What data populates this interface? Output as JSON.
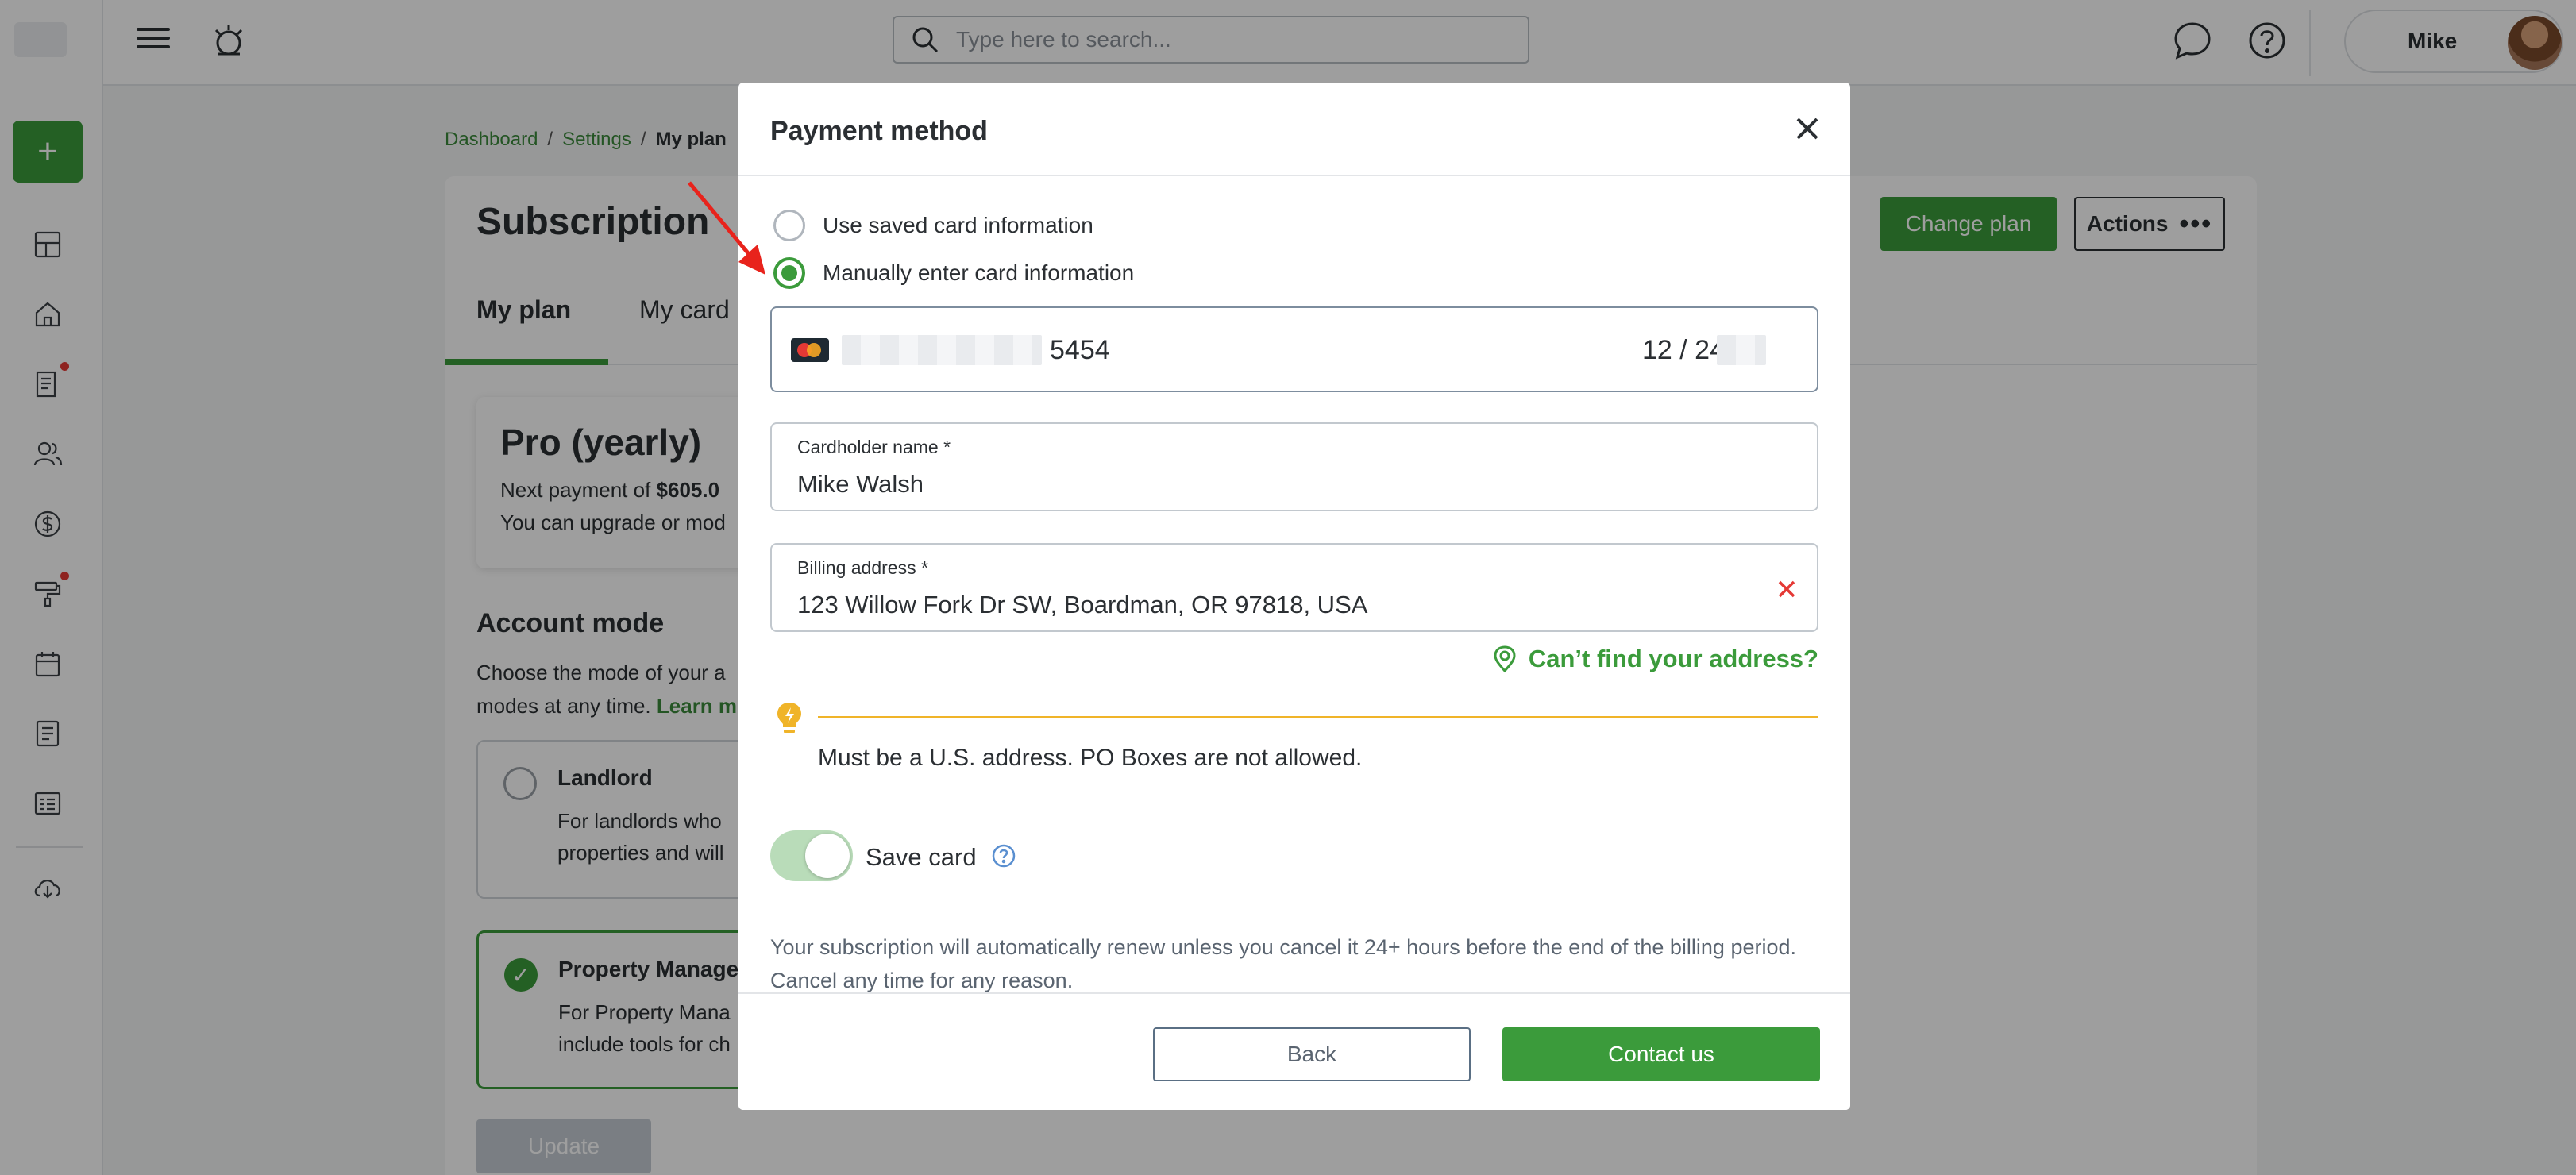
{
  "topbar": {
    "search_placeholder": "Type here to search...",
    "user_name": "Mike"
  },
  "breadcrumb": {
    "items": [
      "Dashboard",
      "Settings"
    ],
    "current": "My plan"
  },
  "page": {
    "title": "Subscription",
    "change_plan_label": "Change plan",
    "actions_label": "Actions",
    "tabs": [
      "My plan",
      "My card"
    ],
    "plan_name": "Pro (yearly)",
    "next_payment_prefix": "Next payment of",
    "next_payment_amount": "$605.0",
    "upgrade_text": "You can upgrade or mod",
    "account_mode_title": "Account mode",
    "account_mode_desc_1": "Choose the mode of your a",
    "account_mode_desc_2": "modes at any time.",
    "learn_more": "Learn m",
    "modes": [
      {
        "name": "Landlord",
        "desc_1": "For landlords who",
        "desc_2": "properties and will"
      },
      {
        "name": "Property Manager",
        "desc_1": "For Property Mana",
        "desc_2": "include tools for ch"
      }
    ],
    "update_label": "Update"
  },
  "modal": {
    "title": "Payment method",
    "radio_saved_label": "Use saved card information",
    "radio_manual_label": "Manually enter card information",
    "card_last4": "5454",
    "card_expiry": "12 / 24",
    "cardholder_label": "Cardholder name *",
    "cardholder_value": "Mike Walsh",
    "billing_label": "Billing address *",
    "billing_value": "123 Willow Fork Dr SW, Boardman, OR 97818, USA",
    "cant_find_label": "Can’t find your address?",
    "hint_text": "Must be a U.S. address. PO Boxes are not allowed.",
    "save_card_label": "Save card",
    "save_card_on": true,
    "renew_text": "Your subscription will automatically renew unless you cancel it 24+ hours before the end of the billing period. Cancel any time for any reason.",
    "back_label": "Back",
    "contact_label": "Contact us"
  },
  "colors": {
    "accent_green": "#3b9b3b",
    "warning_yellow": "#f0b429",
    "danger_red": "#e53935",
    "annotation_arrow": "#e8231c"
  }
}
